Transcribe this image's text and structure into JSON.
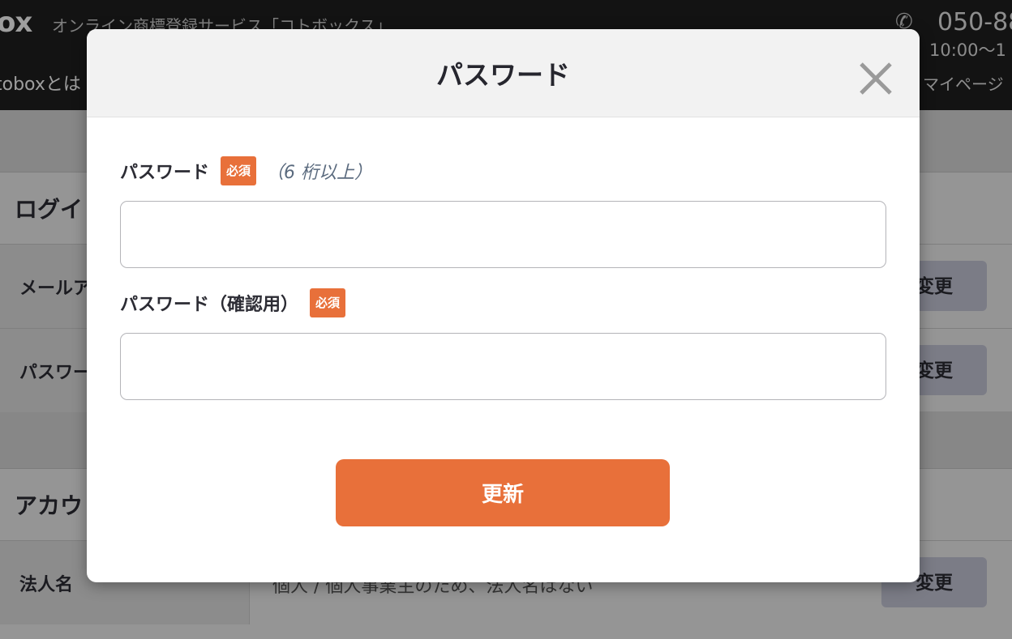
{
  "site": {
    "logo_fragment": "ox",
    "tagline": "オンライン商標登録サービス「コトボックス」",
    "phone_number": "050-88",
    "business_hours": "10:00〜1",
    "nav_about": "toboxとは",
    "nav_mypage": "マイページ"
  },
  "background": {
    "login_section_title": "ログイ",
    "account_section_title": "アカウ",
    "rows": [
      {
        "label": "メールア",
        "value": "",
        "button": "変更"
      },
      {
        "label": "パスワー",
        "value": "",
        "button": "変更"
      },
      {
        "label": "法人名",
        "value": "個人 / 個人事業主のため、法人名はない",
        "button": "変更"
      }
    ]
  },
  "modal": {
    "title": "パスワード",
    "password_label": "パスワード",
    "required_badge": "必須",
    "password_hint": "（6 桁以上）",
    "password_value": "",
    "confirm_label": "パスワード（確認用）",
    "confirm_value": "",
    "submit_label": "更新"
  },
  "colors": {
    "accent": "#e8703a",
    "header_bg": "#202020",
    "change_button_bg": "#c7c8d9"
  },
  "icons": {
    "close": "close-icon",
    "phone": "phone-icon"
  }
}
